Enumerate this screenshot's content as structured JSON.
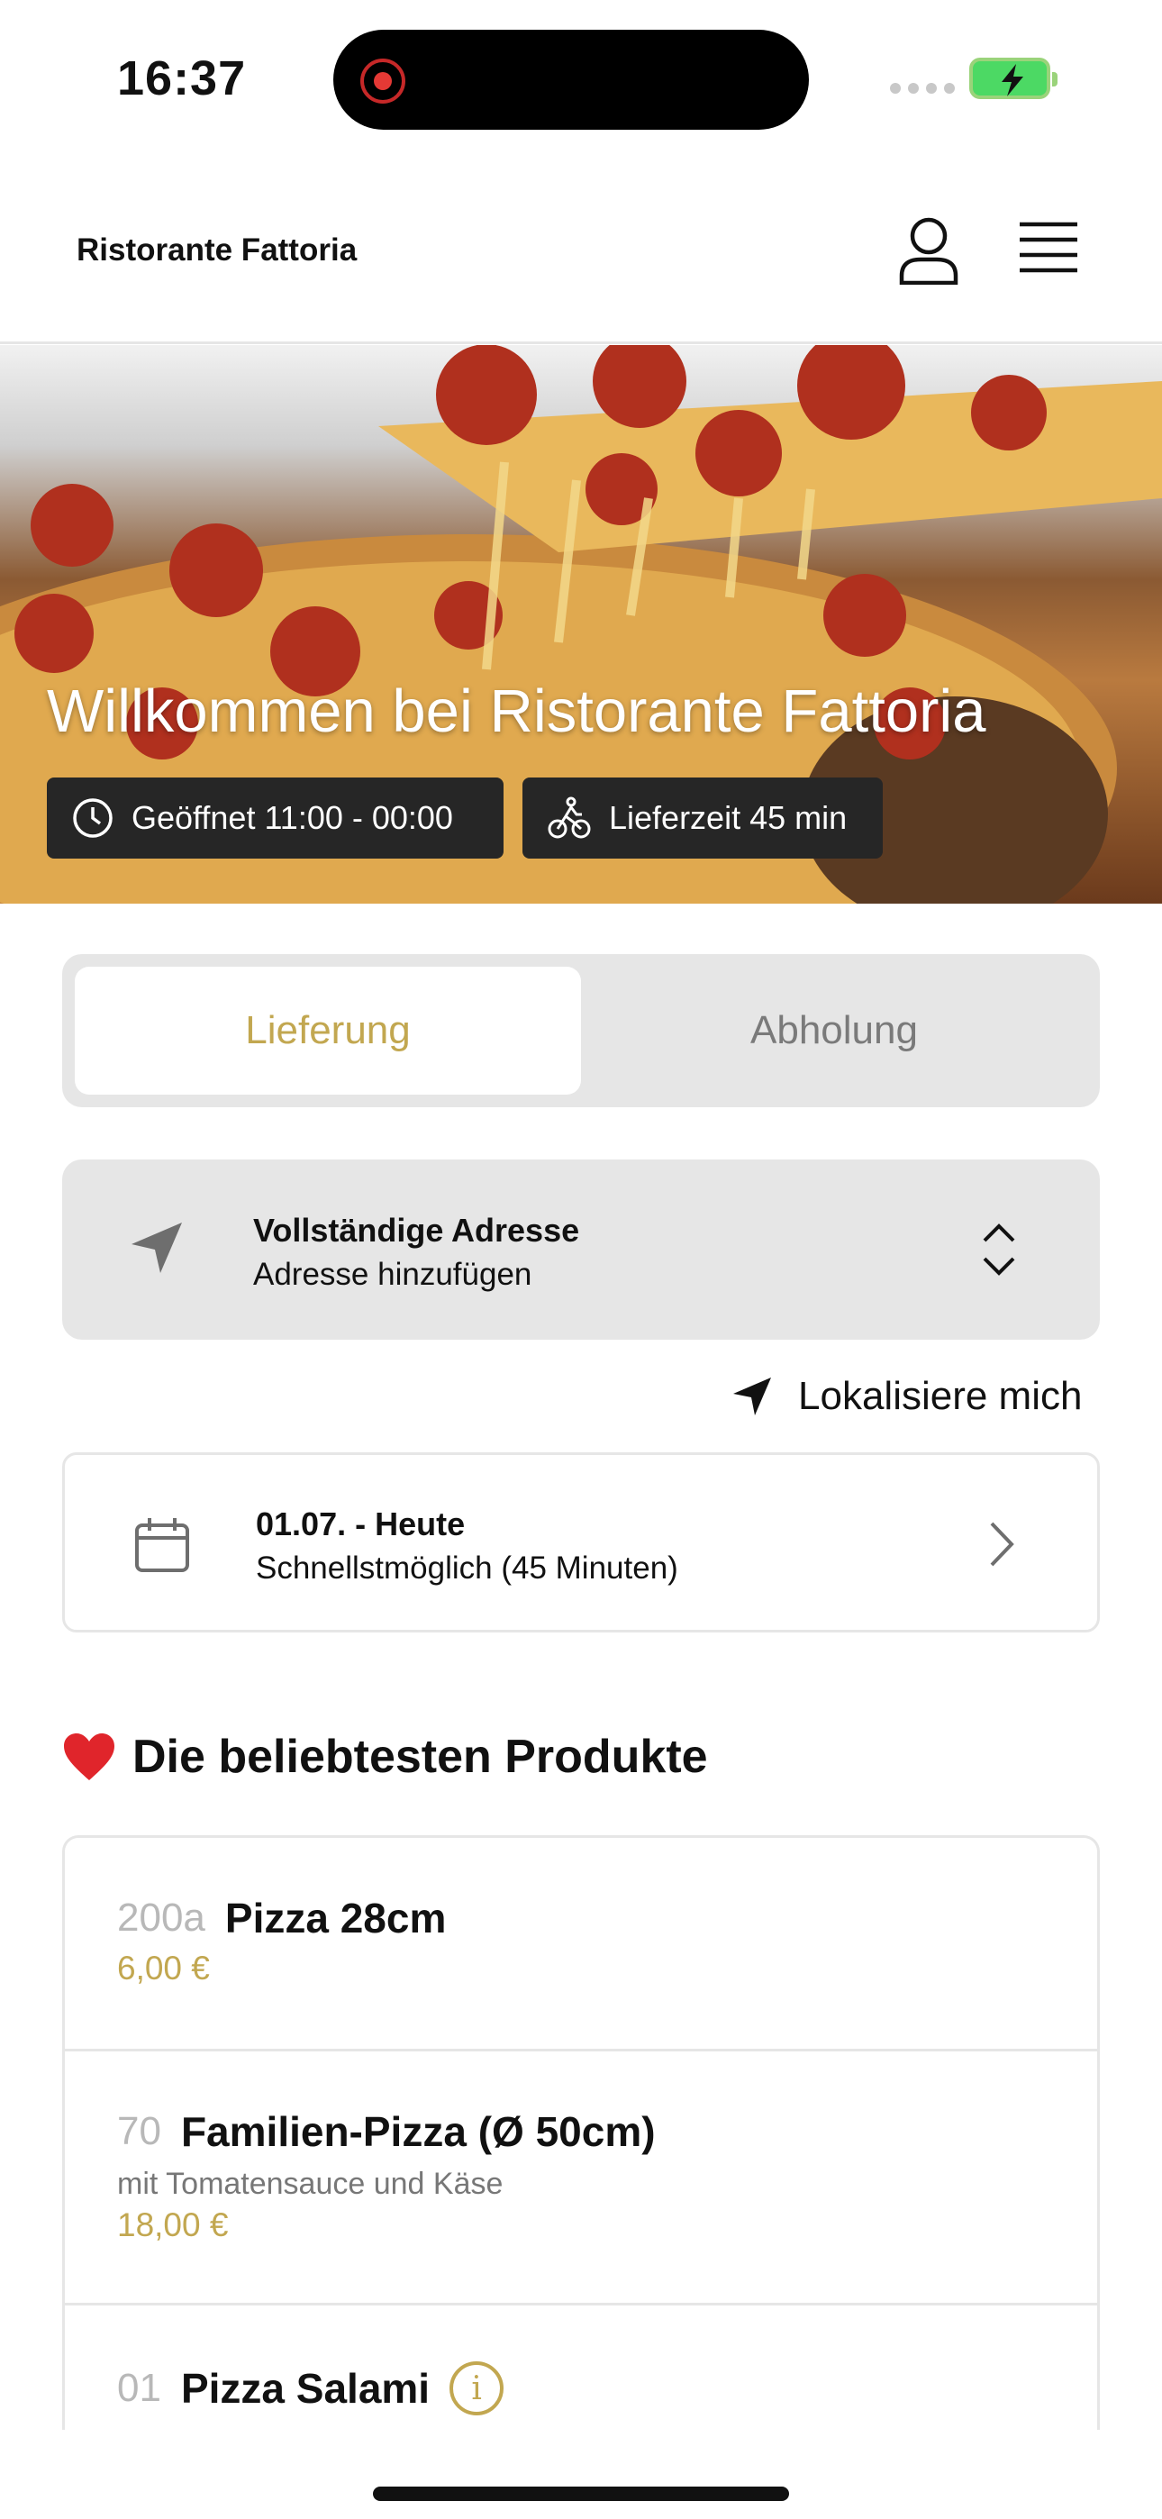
{
  "status_bar": {
    "time": "16:37"
  },
  "header": {
    "brand": "Ristorante Fattoria"
  },
  "hero": {
    "title": "Willkommen bei Ristorante Fattoria",
    "opening_hours": "Geöffnet 11:00 - 00:00",
    "delivery_time": "Lieferzeit 45 min"
  },
  "tabs": {
    "delivery": "Lieferung",
    "pickup": "Abholung"
  },
  "address": {
    "title": "Vollständige Adresse",
    "subtitle": "Adresse hinzufügen"
  },
  "locate": {
    "label": "Lokalisiere mich"
  },
  "date": {
    "title": "01.07. - Heute",
    "subtitle": "Schnellstmöglich (45 Minuten)"
  },
  "products_section": {
    "title": "Die beliebtesten Produkte"
  },
  "products": [
    {
      "number": "200a",
      "name": "Pizza 28cm",
      "price": "6,00 €"
    },
    {
      "number": "70",
      "name": "Familien-Pizza (Ø 50cm)",
      "description": "mit Tomatensauce und Käse",
      "price": "18,00 €"
    },
    {
      "number": "01",
      "name": "Pizza Salami"
    }
  ],
  "colors": {
    "accent": "#c2a750",
    "chip_bg": "#262626",
    "panel_bg": "#e6e6e6"
  },
  "icons": [
    "user-icon",
    "menu-icon",
    "clock-icon",
    "bike-icon",
    "location-arrow-icon",
    "chevron-up-down-icon",
    "calendar-icon",
    "chevron-right-icon",
    "heart-icon",
    "info-icon"
  ]
}
